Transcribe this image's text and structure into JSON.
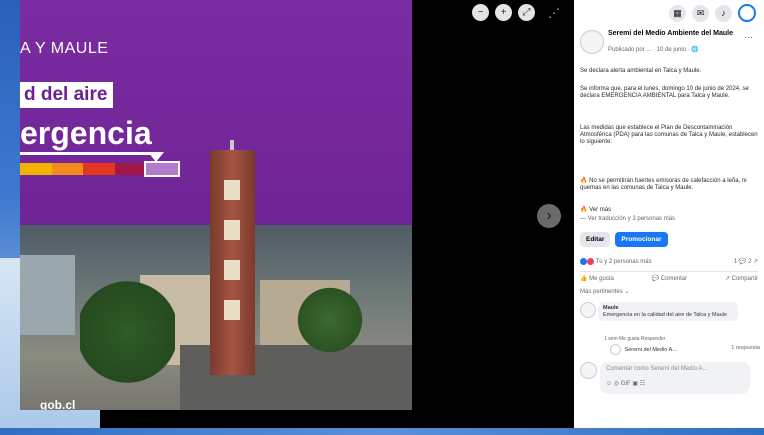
{
  "viewer": {
    "poster": {
      "region": "A Y MAULE",
      "quality_label": "d del aire",
      "level_label": "ergencia",
      "watermark": "gob.cl",
      "colors": {
        "background": "#6f2496",
        "accent": "#ffffff"
      },
      "scale_colors": [
        "#f3b200",
        "#f28a1c",
        "#e3371e",
        "#a0184a",
        "#b57bcb"
      ]
    },
    "icons": [
      "zoom-out-icon",
      "zoom-in-icon",
      "fullscreen-icon"
    ],
    "more_glyph": "⋰",
    "next_glyph": "›"
  },
  "topbar": {
    "icons": [
      "menu-grid-icon",
      "messenger-icon",
      "notifications-icon",
      "account-avatar"
    ]
  },
  "post": {
    "author": "Seremi del Medio Ambiente del Maule",
    "meta": "Publicado por ...  ·  10 de junio  · 🌐",
    "more": "···",
    "paragraphs": [
      "Se declara alerta ambiental en Talca y Maule.",
      "Se informa que, para el lunes, domingo 10 de junio de 2024, se declara EMERGENCIA AMBIENTAL para Talca y Maule.",
      "Las medidas que establece el Plan de Descontaminación Atmosférica (PDA) para las comunas de Talca y Maule, establecen lo siguiente:",
      "🔥 No se permitirán fuentes emisoras de calefacción a leña, ni quemas en las comunas de Talca y Maule.",
      "🔥 Ver más",
      "— Ver traducción y 3 personas más"
    ],
    "buttons": {
      "edit": "Editar",
      "promote": "Promocionar"
    },
    "stats": {
      "reactions": "Tú y 2 personas más",
      "counts": "1 💬  2 ↗"
    },
    "actions": {
      "like": "👍 Me gusta",
      "comment": "💬 Comentar",
      "share": "↗ Compartir"
    },
    "most_relevant": "Más pertinentes ⌄",
    "comment": {
      "author": "Maule",
      "text": "Emergencia en la calidad del aire de Talca y Maule",
      "actions": "1 sem   Me gusta   Responder",
      "reply_name": "Seremi del Medio A...",
      "reply_meta": "1 respuesta"
    },
    "compose": {
      "placeholder": "Comentar como Seremi del Medio A...",
      "tools": "☺  ◎  GIF  ▣  ☷"
    }
  }
}
